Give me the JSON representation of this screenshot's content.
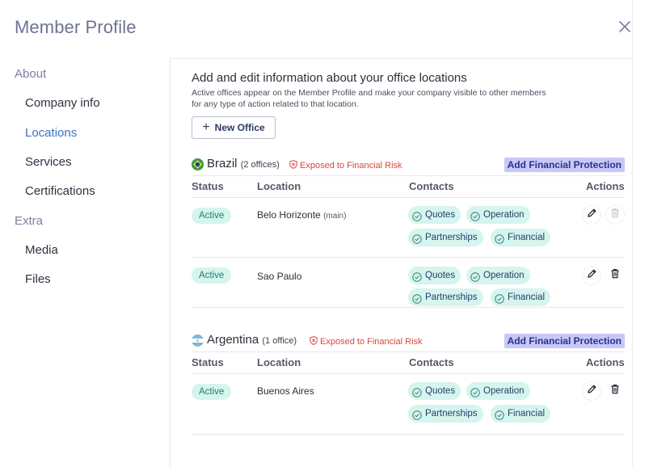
{
  "modal": {
    "title": "Member Profile"
  },
  "sidebar": {
    "sections": [
      {
        "label": "About",
        "items": [
          "Company info",
          "Locations",
          "Services",
          "Certifications"
        ]
      },
      {
        "label": "Extra",
        "items": [
          "Media",
          "Files"
        ]
      }
    ],
    "active_item": "Locations"
  },
  "intro": {
    "title": "Add and edit information about your office locations",
    "description": "Active offices appear on the Member Profile and make your company visible to other members for any type of action related to that location."
  },
  "new_office_label": "New Office",
  "columns": {
    "status": "Status",
    "location": "Location",
    "contacts": "Contacts",
    "actions": "Actions"
  },
  "groups": [
    {
      "country": "Brazil",
      "office_count": "(2 offices)",
      "risk_label": "Exposed to Financial Risk",
      "protect_label": "Add Financial Protection",
      "offices": [
        {
          "status": "Active",
          "location": "Belo Horizonte",
          "tag": "(main)",
          "contacts": [
            "Quotes",
            "Operation",
            "Partnerships",
            "Financial"
          ],
          "delete_enabled": false
        },
        {
          "status": "Active",
          "location": "Sao Paulo",
          "tag": "",
          "contacts": [
            "Quotes",
            "Operation",
            "Partnerships",
            "Financial"
          ],
          "delete_enabled": true
        }
      ]
    },
    {
      "country": "Argentina",
      "office_count": "(1 office)",
      "risk_label": "Exposed to Financial Risk",
      "protect_label": "Add Financial Protection",
      "offices": [
        {
          "status": "Active",
          "location": "Buenos Aires",
          "tag": "",
          "contacts": [
            "Quotes",
            "Operation",
            "Partnerships",
            "Financial"
          ],
          "delete_enabled": true
        }
      ]
    }
  ],
  "colors": {
    "accent": "#3d73b8",
    "status_bg": "#d5f5ee",
    "risk": "#d9473f",
    "protect_bg": "#c7c8f5"
  },
  "icons": {
    "close": "close-icon",
    "plus": "plus-icon",
    "shield": "shield-x-icon",
    "check": "check-circle-icon",
    "edit": "pencil-icon",
    "delete": "trash-icon"
  }
}
